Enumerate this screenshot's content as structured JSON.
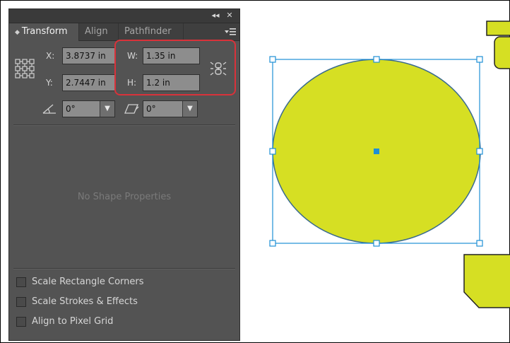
{
  "panel": {
    "collapse_glyph": "◂◂",
    "close_glyph": "✕",
    "tabs": [
      {
        "label": "Transform",
        "active": true,
        "arrows": "◆"
      },
      {
        "label": "Align",
        "active": false
      },
      {
        "label": "Pathfinder",
        "active": false
      }
    ],
    "menu_icon": "panel-menu-icon"
  },
  "transform": {
    "x_label": "X:",
    "x_value": "3.8737 in",
    "y_label": "Y:",
    "y_value": "2.7447 in",
    "w_label": "W:",
    "w_value": "1.35 in",
    "h_label": "H:",
    "h_value": "1.2 in",
    "rotate_value": "0°",
    "shear_value": "0°",
    "no_shape_text": "No Shape Properties"
  },
  "options": [
    {
      "label": "Scale Rectangle Corners",
      "checked": false
    },
    {
      "label": "Scale Strokes & Effects",
      "checked": false
    },
    {
      "label": "Align to Pixel Grid",
      "checked": false
    }
  ],
  "colors": {
    "panel_bg": "#535353",
    "field_bg": "#8d8d8d",
    "highlight": "#d9323a",
    "shape_fill": "#d6df23",
    "selection": "#1e90d6"
  },
  "icons": [
    "reference-point-icon",
    "constrain-proportions-icon",
    "rotate-icon",
    "shear-icon",
    "chevron-down-icon"
  ]
}
